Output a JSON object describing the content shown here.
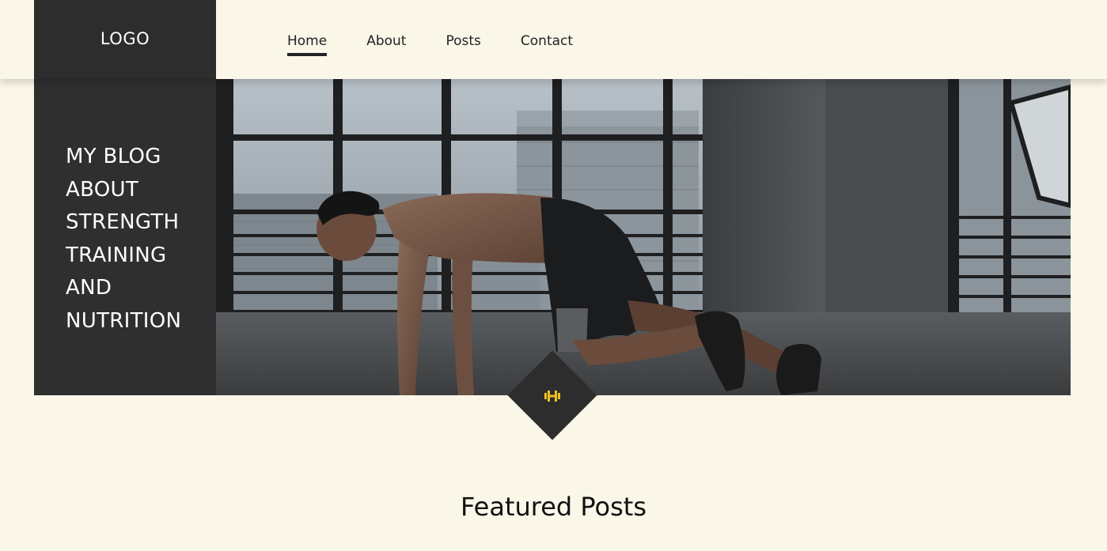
{
  "header": {
    "logo": "LOGO",
    "nav": [
      {
        "label": "Home",
        "active": true
      },
      {
        "label": "About",
        "active": false
      },
      {
        "label": "Posts",
        "active": false
      },
      {
        "label": "Contact",
        "active": false
      }
    ]
  },
  "hero": {
    "title_lines": [
      "MY BLOG",
      "ABOUT",
      "STRENGTH",
      "TRAINING",
      "AND",
      "NUTRITION"
    ],
    "image_subject": "man doing mountain climber exercise in industrial gym"
  },
  "badge": {
    "icon": "dumbbell-icon",
    "icon_color": "#f0c020"
  },
  "featured": {
    "title": "Featured Posts"
  },
  "colors": {
    "background": "#faf6e8",
    "dark": "#2d2d2d",
    "accent": "#f0c020"
  }
}
